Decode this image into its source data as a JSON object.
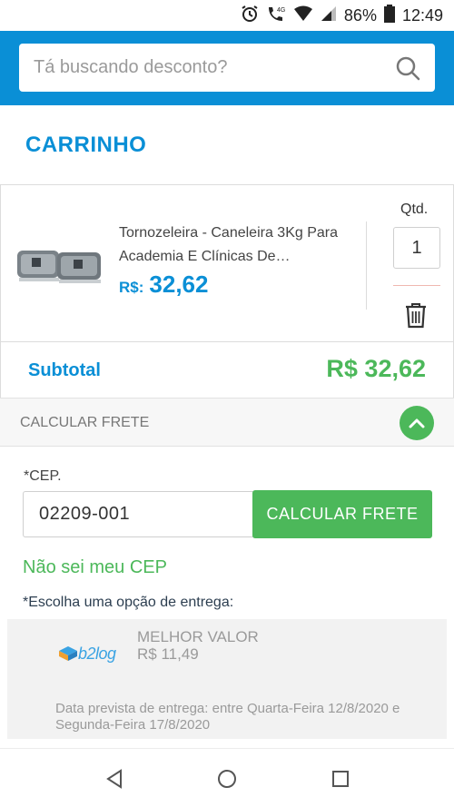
{
  "status_bar": {
    "battery": "86%",
    "time": "12:49",
    "network": "4G"
  },
  "search": {
    "placeholder": "Tá buscando desconto?"
  },
  "page_title": "CARRINHO",
  "product": {
    "name": "Tornozeleira - Caneleira 3Kg Para Academia E Clínicas De…",
    "price_currency": "R$:",
    "price_value": "32,62",
    "qty_label": "Qtd.",
    "qty_value": "1"
  },
  "subtotal": {
    "label": "Subtotal",
    "amount": "R$ 32,62"
  },
  "frete": {
    "toggle_label": "CALCULAR FRETE",
    "cep_label": "*CEP.",
    "cep_value": "02209-001",
    "calc_button": "CALCULAR FRETE",
    "unknown_cep_link": "Não sei meu CEP",
    "choose_label": "*Escolha uma opção de entrega:"
  },
  "shipping_option": {
    "logo_text": "b2log",
    "title": "MELHOR VALOR",
    "price": "R$ 11,49",
    "delivery_estimate": "Data prevista de entrega: entre Quarta-Feira 12/8/2020 e Segunda-Feira 17/8/2020"
  },
  "colors": {
    "brand_blue": "#0a8fd6",
    "green": "#4cb85a"
  },
  "icons": [
    "alarm-icon",
    "phone-4g-icon",
    "wifi-icon",
    "signal-icon",
    "battery-icon",
    "search-icon",
    "trash-icon",
    "chevron-up-icon",
    "back-nav-icon",
    "home-nav-icon",
    "recents-nav-icon"
  ]
}
